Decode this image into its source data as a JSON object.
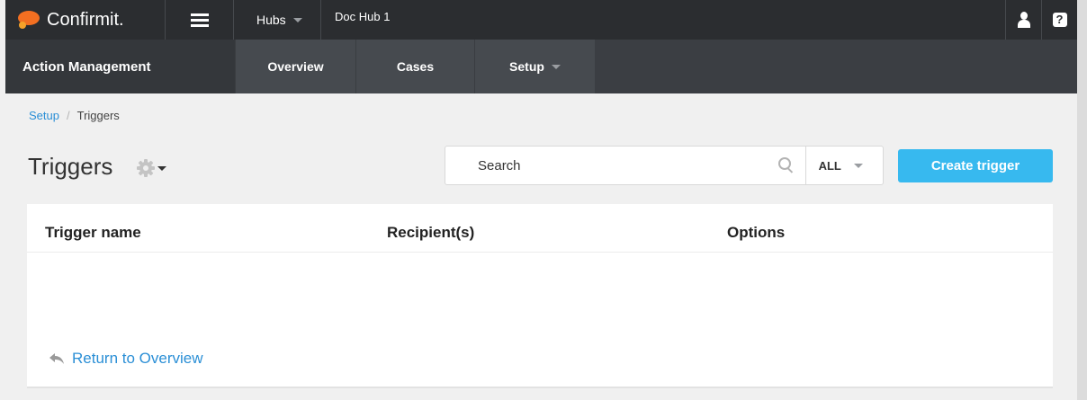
{
  "topbar": {
    "brand": "Confirmit.",
    "hubs_label": "Hubs",
    "current_hub": "Doc Hub 1",
    "icons": [
      "menu-icon",
      "user-icon",
      "help-icon"
    ],
    "help_glyph": "?"
  },
  "nav": {
    "section_title": "Action Management",
    "tabs": [
      {
        "label": "Overview"
      },
      {
        "label": "Cases"
      },
      {
        "label": "Setup"
      }
    ]
  },
  "breadcrumb": {
    "parent": "Setup",
    "separator": "/",
    "current": "Triggers"
  },
  "page": {
    "title": "Triggers"
  },
  "search": {
    "placeholder": "Search",
    "filter_value": "ALL"
  },
  "actions": {
    "create_label": "Create trigger"
  },
  "table": {
    "columns": [
      "Trigger name",
      "Recipient(s)",
      "Options"
    ],
    "rows": []
  },
  "footer": {
    "return_label": "Return to Overview"
  },
  "colors": {
    "topbar": "#2b2d30",
    "navbar": "#3f4247",
    "accent": "#37b9ef",
    "link": "#2b8fd6",
    "brand_orange": "#f36f21"
  }
}
